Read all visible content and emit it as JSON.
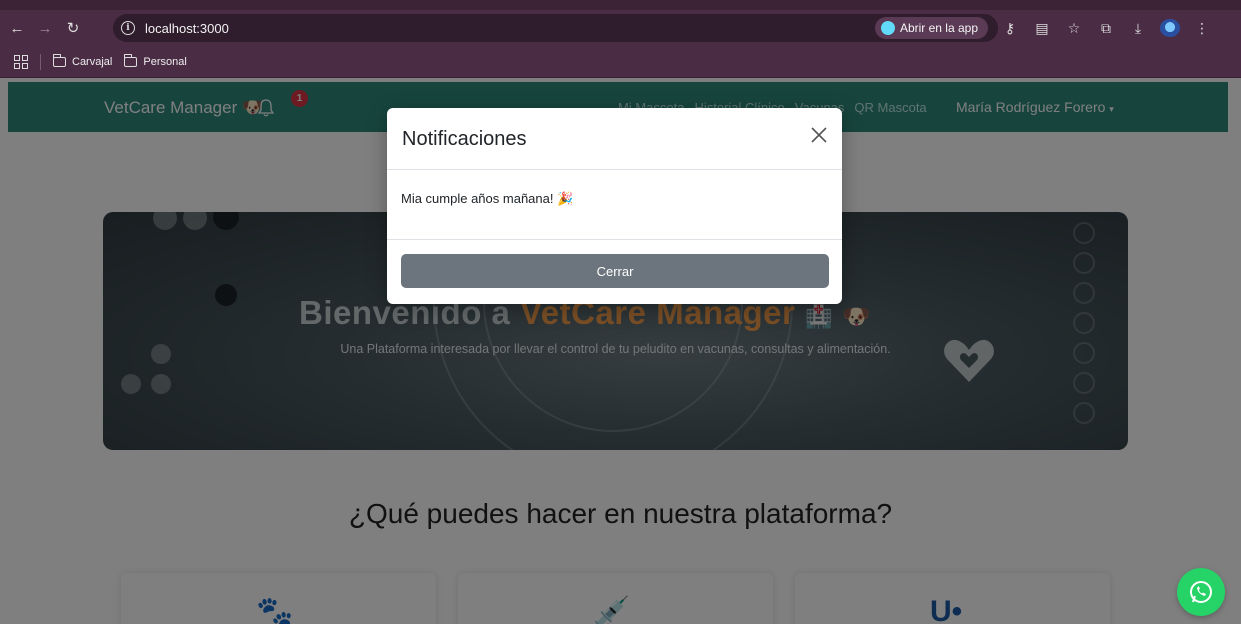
{
  "browser": {
    "url": "localhost:3000",
    "open_app_label": "Abrir en la app",
    "bookmarks": [
      "Carvajal",
      "Personal"
    ],
    "icons": [
      "back-icon",
      "forward-icon",
      "reload-icon",
      "site-info-icon",
      "password-key-icon",
      "translate-icon",
      "star-icon",
      "extensions-icon",
      "download-icon",
      "profile-icon",
      "menu-icon",
      "apps-grid-icon",
      "folder-icon"
    ]
  },
  "navbar": {
    "brand": "VetCare Manager",
    "brand_emoji": "🐶",
    "notification_count": "1",
    "links": [
      "Mi Mascota",
      "Historial Clínico",
      "Vacunas",
      "QR Mascota"
    ],
    "user": "María Rodríguez Forero"
  },
  "hero": {
    "title_prefix": "Bienvenido a ",
    "title_highlight": "VetCare Manager",
    "subtitle": "Una Plataforma interesada por llevar el control de tu peludito en vacunas, consultas y alimentación."
  },
  "features": {
    "title": "¿Qué puedes hacer en nuestra plataforma?",
    "cards": [
      {
        "icon": "paw-icon",
        "color": "#1f5aa6"
      },
      {
        "icon": "syringe-icon",
        "color": "#1f5aa6"
      },
      {
        "icon": "stethoscope-icon",
        "color": "#1f5aa6"
      }
    ]
  },
  "modal": {
    "title": "Notificaciones",
    "message": "Mia cumple años mañana! 🎉",
    "close_button": "Cerrar"
  },
  "colors": {
    "navbar": "#2e8b7d",
    "browser_frame": "#4a2c44",
    "highlight": "#f39c4a",
    "badge": "#dc3545",
    "button_secondary": "#6c757d",
    "whatsapp": "#25d366"
  }
}
